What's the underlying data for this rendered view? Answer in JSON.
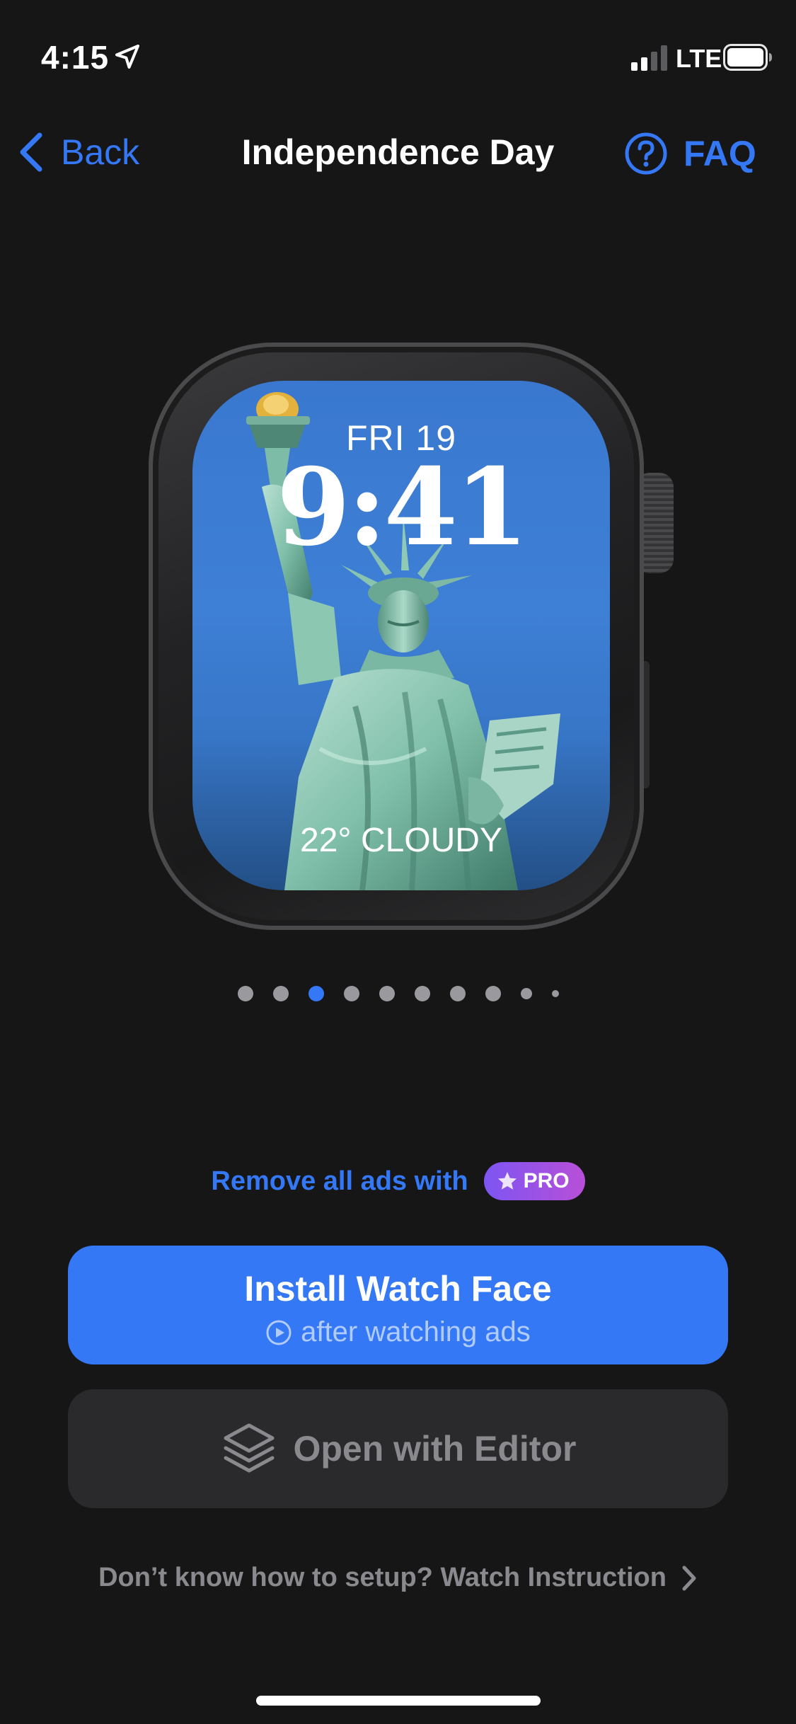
{
  "status_bar": {
    "time": "4:15",
    "network": "LTE"
  },
  "nav": {
    "back_label": "Back",
    "title": "Independence Day",
    "faq_label": "FAQ"
  },
  "watch_face": {
    "date": "FRI 19",
    "time": "9:41",
    "weather": "22° CLOUDY"
  },
  "pager": {
    "total": 10,
    "active_index": 2
  },
  "pro_promo": {
    "text": "Remove all ads with",
    "badge": "PRO"
  },
  "install_button": {
    "label": "Install Watch Face",
    "sublabel": "after watching ads"
  },
  "editor_button": {
    "label": "Open with Editor"
  },
  "instruction_link": {
    "label": "Don’t know how to setup? Watch Instruction"
  },
  "colors": {
    "accent": "#3478f6",
    "background": "#161617",
    "secondary_button": "#2a2a2c",
    "muted_text": "#8a8a8e",
    "pro_gradient_start": "#7d55f2",
    "pro_gradient_end": "#b84fd8"
  },
  "icons": {
    "location": "location-arrow-icon",
    "signal": "cellular-signal-icon",
    "battery": "battery-icon",
    "back": "chevron-left-icon",
    "faq": "question-circle-icon",
    "pro": "star-icon",
    "play": "play-circle-icon",
    "editor": "layers-icon",
    "instruction": "chevron-right-icon"
  }
}
